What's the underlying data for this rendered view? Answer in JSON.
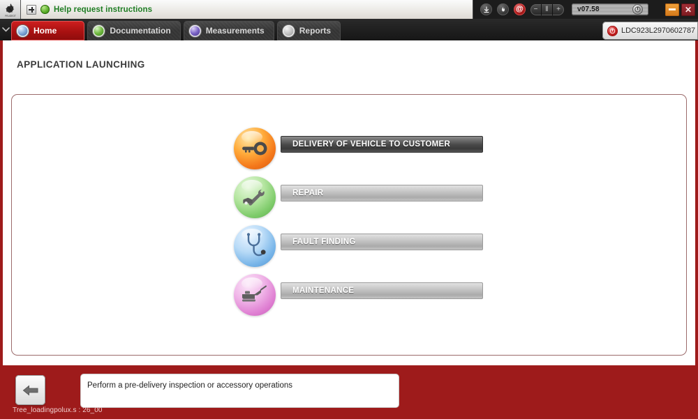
{
  "window": {
    "brand_logo": "peugeot-lion-logo",
    "help_bar": {
      "expand_icon": "plus-box-icon",
      "status_icon": "green-status-icon",
      "text": "Help request instructions"
    },
    "tools": [
      {
        "name": "download-icon",
        "glyph": "↓"
      },
      {
        "name": "flame-icon",
        "glyph": "●"
      },
      {
        "name": "at-mail-icon",
        "glyph": "@"
      }
    ],
    "segmented": {
      "minus_label": "−",
      "pause_label": "‖",
      "plus_label": "+"
    },
    "version": {
      "label": "v07.58",
      "knob_icon": "dial-knob-icon"
    },
    "controls": {
      "minimize_label": "–",
      "close_label": "✕"
    }
  },
  "tabs": {
    "overflow_icon": "chevron-down-icon",
    "items": [
      {
        "label": "Home",
        "icon": "home-globe-icon",
        "active": true
      },
      {
        "label": "Documentation",
        "icon": "document-leaf-icon",
        "active": false
      },
      {
        "label": "Measurements",
        "icon": "waveform-icon",
        "active": false
      },
      {
        "label": "Reports",
        "icon": "report-page-icon",
        "active": false
      }
    ],
    "vehicle": {
      "power_icon": "power-icon",
      "vin": "LDC923L2970602787"
    }
  },
  "main": {
    "title": "APPLICATION LAUNCHING",
    "menu": [
      {
        "label": "DELIVERY OF VEHICLE TO CUSTOMER",
        "icon": "car-key-icon",
        "color": "#f4781b",
        "state": "selected"
      },
      {
        "label": "REPAIR",
        "icon": "wrench-car-icon",
        "color": "#7ecb6a",
        "state": "normal"
      },
      {
        "label": "FAULT FINDING",
        "icon": "stethoscope-icon",
        "color": "#77b4e8",
        "state": "normal"
      },
      {
        "label": "MAINTENANCE",
        "icon": "oil-can-icon",
        "color": "#df7fd2",
        "state": "normal"
      }
    ]
  },
  "footer": {
    "back_icon": "back-arrow-icon",
    "hint": "Perform a pre-delivery inspection or accessory operations",
    "status": "Tree_loadingpolux.s : 26_00"
  },
  "theme": {
    "brand_red": "#9e1b1b",
    "tab_active_red": "#a81111",
    "help_green": "#1e7d23",
    "panel_border": "#9b6b6b"
  }
}
